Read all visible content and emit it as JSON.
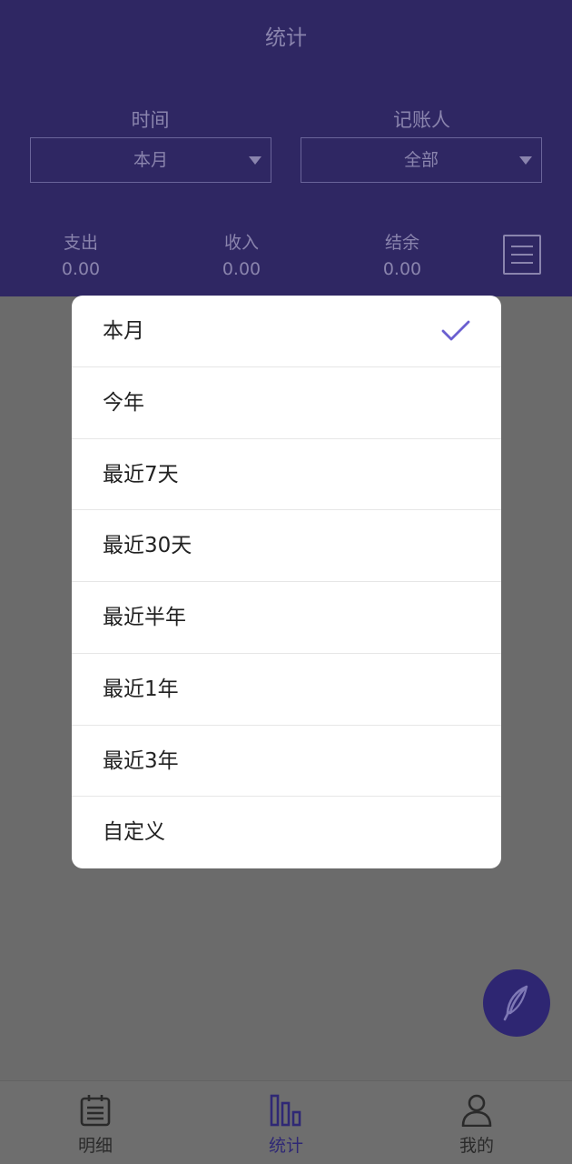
{
  "header": {
    "title": "统计",
    "time_filter": {
      "label": "时间",
      "value": "本月"
    },
    "person_filter": {
      "label": "记账人",
      "value": "全部"
    },
    "summary": [
      {
        "label": "支出",
        "value": "0.00"
      },
      {
        "label": "收入",
        "value": "0.00"
      },
      {
        "label": "结余",
        "value": "0.00"
      }
    ]
  },
  "dropdown": {
    "selected": "本月",
    "options": [
      "本月",
      "今年",
      "最近7天",
      "最近30天",
      "最近半年",
      "最近1年",
      "最近3年",
      "自定义"
    ]
  },
  "bottom_nav": [
    {
      "label": "明细",
      "icon": "notepad-icon",
      "active": false
    },
    {
      "label": "统计",
      "icon": "bar-chart-icon",
      "active": true
    },
    {
      "label": "我的",
      "icon": "person-icon",
      "active": false
    }
  ],
  "fab": {
    "icon": "feather-icon"
  },
  "colors": {
    "accent": "#3d3393",
    "accent_dimmed": "#2f2763",
    "overlay_gray": "#6b6b6b",
    "check": "#6a5fd0"
  }
}
